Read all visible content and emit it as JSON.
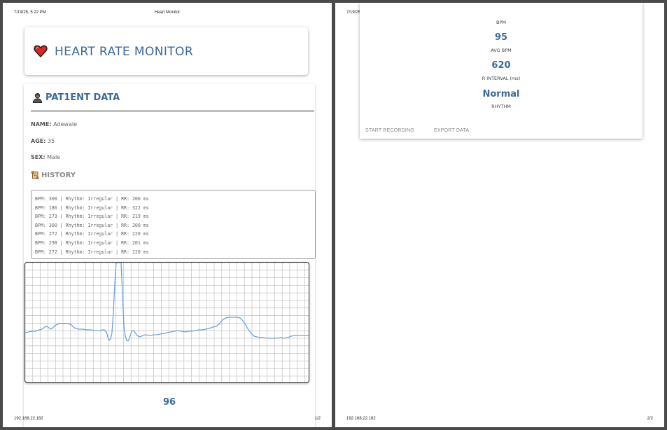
{
  "print_header": {
    "datetime": "7/19/25, 5:22 PM",
    "doc_title": "Heart Monitor"
  },
  "print_footer": {
    "host": "192.168.22.182",
    "page1": "1/2",
    "page2": "2/2"
  },
  "app": {
    "title": "HEART RATE MONITOR",
    "heart_icon": "heart-icon"
  },
  "patient": {
    "section_title": "PAT1ENT DATA",
    "name_label": "NAME:",
    "name_value": "Adewale",
    "age_label": "AGE:",
    "age_value": "35",
    "sex_label": "SEX:",
    "sex_value": "Male"
  },
  "history": {
    "title": "HISTORY",
    "lines": [
      "BPM: 300 | Rhythm: Irregular | RR: 200 ms",
      "BPM: 186 | Rhythm: Irregular | RR: 322 ms",
      "BPM: 273 | Rhythm: Irregular | RR: 219 ms",
      "BPM: 300 | Rhythm: Irregular | RR: 200 ms",
      "BPM: 272 | Rhythm: Irregular | RR: 220 ms",
      "BPM: 298 | Rhythm: Irregular | RR: 201 ms",
      "BPM: 272 | Rhythm: Irregular | RR: 220 ms"
    ]
  },
  "current_bpm": "96",
  "stats": {
    "bpm_label": "BPM",
    "avg_bpm_value": "95",
    "avg_bpm_label": "AVG BPM",
    "rr_value": "620",
    "rr_label": "R INTERVAL (ms)",
    "rhythm_value": "Normal",
    "rhythm_label": "RHYTHM"
  },
  "buttons": {
    "start": "START RECORDING",
    "export": "EXPORT DATA"
  },
  "colors": {
    "accent": "#3d6a96",
    "trace": "#6fa3d8",
    "grid": "#b5b5b5"
  }
}
